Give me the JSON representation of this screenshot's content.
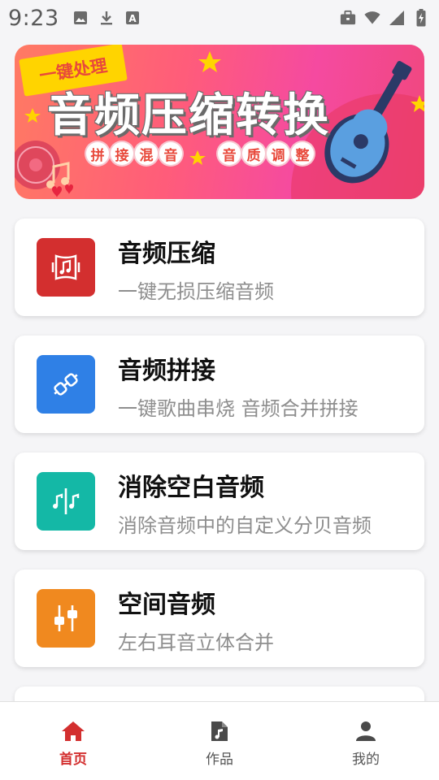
{
  "status_bar": {
    "time": "9:23",
    "icons": [
      "image-icon",
      "download-icon",
      "font-icon",
      "briefcase-icon",
      "wifi-icon",
      "signal-icon",
      "battery-icon"
    ]
  },
  "banner": {
    "ribbon_text": "一键处理",
    "title": "音频压缩转换",
    "chip_group_1": [
      "拼",
      "接",
      "混",
      "音"
    ],
    "chip_group_2": [
      "音",
      "质",
      "调",
      "整"
    ],
    "colors": {
      "gradient_start": "#ff7a63",
      "gradient_end": "#f0477c",
      "ribbon": "#ffd400"
    }
  },
  "features": [
    {
      "title": "音频压缩",
      "subtitle": "一键无损压缩音频",
      "icon": "audio-compress-icon",
      "color": "#d32f2f"
    },
    {
      "title": "音频拼接",
      "subtitle": "一键歌曲串烧 音频合并拼接",
      "icon": "link-plug-icon",
      "color": "#2f80e6"
    },
    {
      "title": "消除空白音频",
      "subtitle": "消除音频中的自定义分贝音频",
      "icon": "music-split-icon",
      "color": "#14b8a6"
    },
    {
      "title": "空间音频",
      "subtitle": "左右耳音立体合并",
      "icon": "equalizer-icon",
      "color": "#f0891f"
    }
  ],
  "bottom_nav": {
    "items": [
      {
        "label": "首页",
        "icon": "home-icon",
        "active": true
      },
      {
        "label": "作品",
        "icon": "music-file-icon",
        "active": false
      },
      {
        "label": "我的",
        "icon": "person-icon",
        "active": false
      }
    ],
    "active_color": "#d32f2f"
  }
}
